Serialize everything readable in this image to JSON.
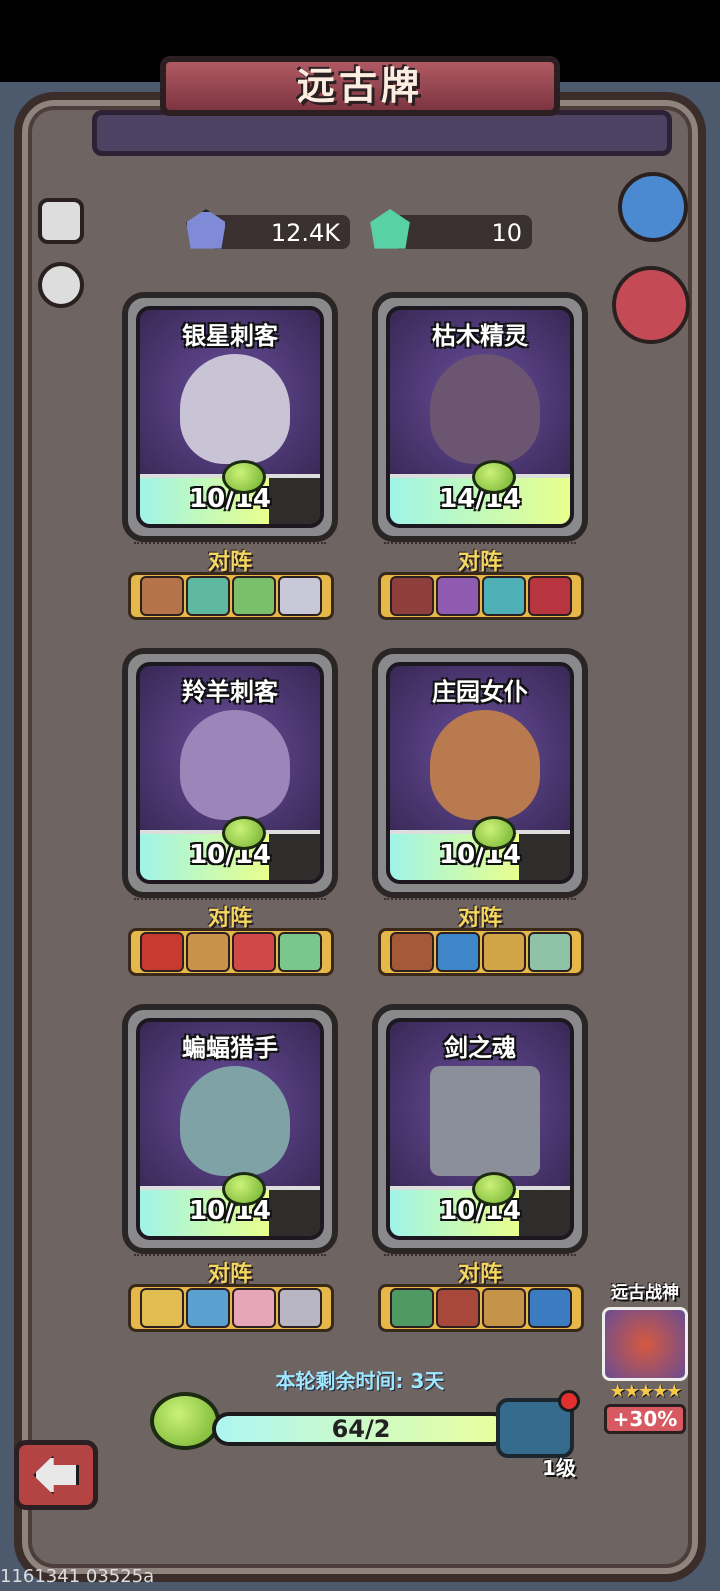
{
  "title": "远古牌",
  "resources": [
    {
      "icon": "blue-crystal-icon",
      "value": "12.4K"
    },
    {
      "icon": "green-crystal-icon",
      "value": "10"
    }
  ],
  "side_buttons": {
    "info": "info-icon",
    "history": "history-icon",
    "ranking": "ranking-podium-icon",
    "shop": "shop-icon"
  },
  "cards": [
    {
      "name": "银星刺客",
      "progress": "10/14",
      "fill": 0.714,
      "counter_label": "对阵"
    },
    {
      "name": "枯木精灵",
      "progress": "14/14",
      "fill": 1.0,
      "counter_label": "对阵"
    },
    {
      "name": "羚羊刺客",
      "progress": "10/14",
      "fill": 0.714,
      "counter_label": "对阵"
    },
    {
      "name": "庄园女仆",
      "progress": "10/14",
      "fill": 0.714,
      "counter_label": "对阵"
    },
    {
      "name": "蝙蝠猎手",
      "progress": "10/14",
      "fill": 0.714,
      "counter_label": "对阵"
    },
    {
      "name": "剑之魂",
      "progress": "10/14",
      "fill": 0.714,
      "counter_label": "对阵"
    }
  ],
  "timer": "本轮剩余时间: 3天",
  "main_progress": {
    "text": "64/2",
    "fill": 1.0
  },
  "level": "1级",
  "ancient_god": {
    "label": "远古战神",
    "stars": "★★★★★",
    "bonus": "+30%"
  },
  "watermark": "1161341 03525a",
  "colors": {
    "accent": "#f3d75e",
    "banner": "#a34e59",
    "bar_fill": "#dff7a0"
  }
}
